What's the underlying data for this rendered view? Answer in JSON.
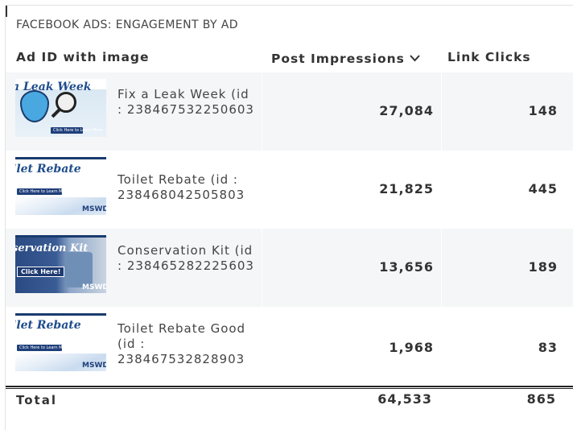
{
  "widget": {
    "title": "FACEBOOK ADS: ENGAGEMENT BY AD"
  },
  "columns": {
    "ad": "Ad ID with image",
    "impressions": "Post Impressions",
    "impressions_sort_icon": "chevron-down-icon",
    "clicks": "Link Clicks"
  },
  "rows": [
    {
      "name": "Fix a Leak Week (id : 238467532250603",
      "thumb_text": "a Leak Week",
      "thumb_button": "Click Here to Learn More",
      "impressions": "27,084",
      "clicks": "148"
    },
    {
      "name": "Toilet Rebate (id : 238468042505803",
      "thumb_text": "ilet Rebate",
      "thumb_button": "Click Here to Learn More!",
      "thumb_logo": "MSWD",
      "impressions": "21,825",
      "clicks": "445"
    },
    {
      "name": "Conservation Kit (id : 238465282225603",
      "thumb_text": "servation Kit",
      "thumb_button": "Click Here!",
      "thumb_logo": "MSWD",
      "impressions": "13,656",
      "clicks": "189"
    },
    {
      "name": "Toilet Rebate Good (id : 238467532828903",
      "thumb_text": "ilet Rebate",
      "thumb_button": "Click Here to Learn More!",
      "thumb_logo": "MSWD",
      "impressions": "1,968",
      "clicks": "83"
    }
  ],
  "total": {
    "label": "Total",
    "impressions": "64,533",
    "clicks": "865"
  }
}
